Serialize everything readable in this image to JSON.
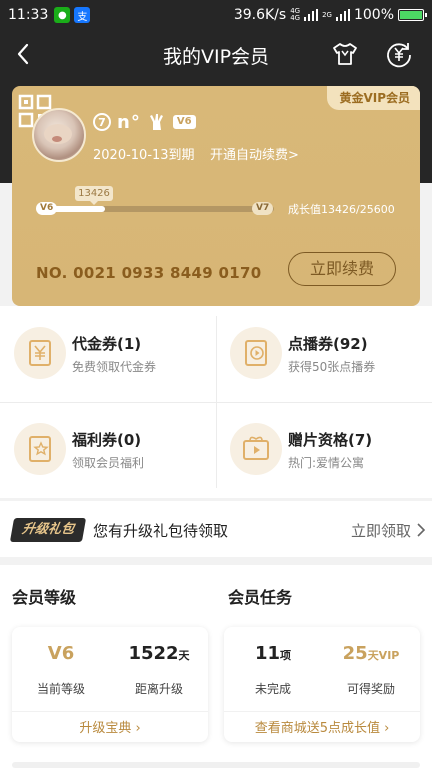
{
  "status_bar": {
    "time": "11:33",
    "speed": "39.6K/s",
    "net_top": "4G",
    "net_mid": "4G",
    "net_bottom": "2G",
    "battery": "100%",
    "battery_level": 1.0
  },
  "nav": {
    "title": "我的VIP会员",
    "icons": [
      "back-arrow-icon",
      "shirt-icon",
      "yuan-exchange-icon"
    ]
  },
  "card": {
    "badge": "黄金VIP会员",
    "level_number": "7",
    "username": "n°",
    "vip_tag": "V6",
    "expire": "2020-10-13到期",
    "auto_renew": "开通自动续费>",
    "growth_tip": "13426",
    "level_start": "V6",
    "level_end": "V7",
    "growth_text": "成长值13426/25600",
    "growth_progress": 0.25,
    "card_no": "NO. 0021 0933 8449 0170",
    "renew_button": "立即续费",
    "colors": {
      "card": "#d9b878",
      "badge_bg": "#f3e2bd",
      "accent": "#8a5d1e"
    }
  },
  "coupons": [
    {
      "title": "代金券(1)",
      "sub": "免费领取代金券",
      "icon": "yuan-ticket-icon"
    },
    {
      "title": "点播券(92)",
      "sub": "获得50张点播券",
      "icon": "play-ticket-icon"
    },
    {
      "title": "福利券(0)",
      "sub": "领取会员福利",
      "icon": "star-ticket-icon"
    },
    {
      "title": "赠片资格(7)",
      "sub": "热门:爱情公寓",
      "icon": "gift-play-icon"
    }
  ],
  "upgrade": {
    "badge": "升级礼包",
    "text": "您有升级礼包待领取",
    "link": "立即领取"
  },
  "member_level": {
    "title": "会员等级",
    "current_value": "V6",
    "current_label": "当前等级",
    "days_value": "1522",
    "days_unit": "天",
    "days_label": "距离升级",
    "link": "升级宝典"
  },
  "member_tasks": {
    "title": "会员任务",
    "items_value": "11",
    "items_unit": "项",
    "items_label": "未完成",
    "reward_value": "25",
    "reward_unit": "天VIP",
    "reward_label": "可得奖励",
    "link": "查看商城送5点成长值"
  }
}
